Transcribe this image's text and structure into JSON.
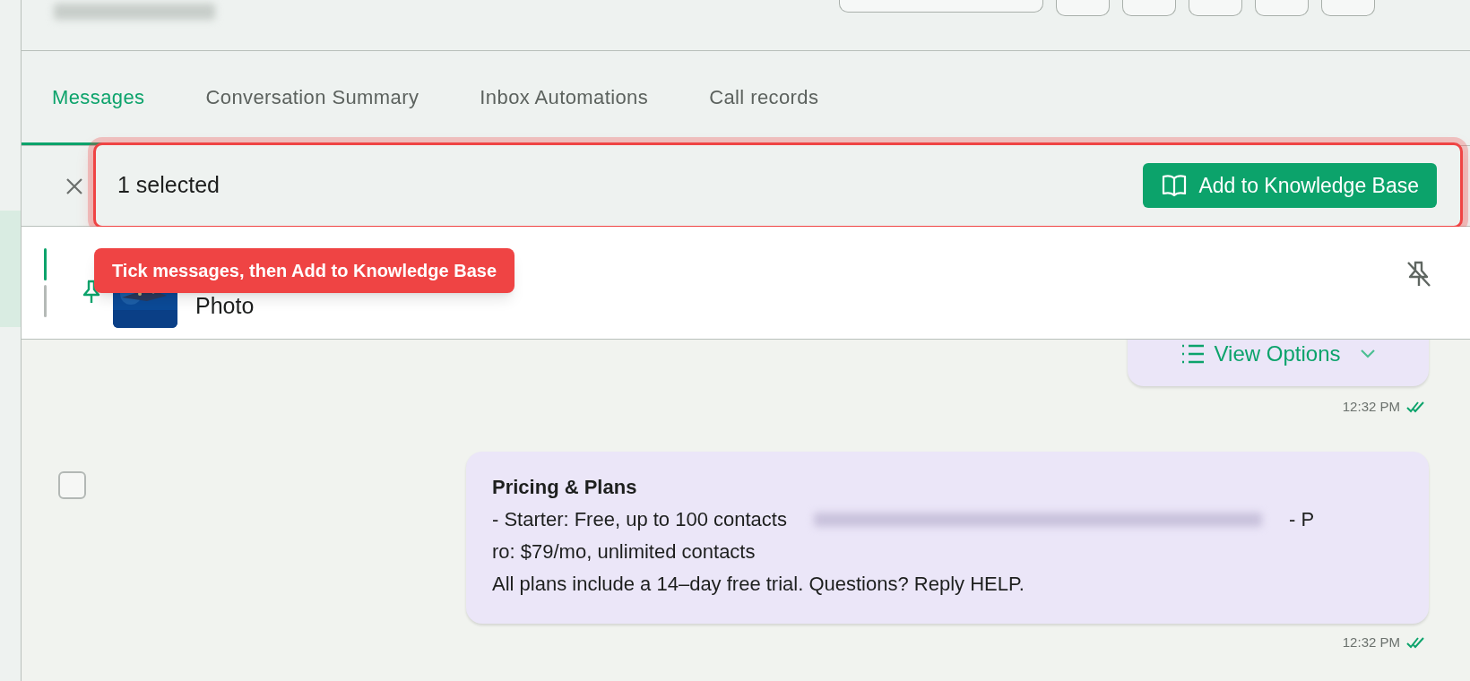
{
  "header": {
    "buttons": [
      {
        "kind": "wide"
      },
      {
        "kind": "small"
      },
      {
        "kind": "small"
      },
      {
        "kind": "small"
      },
      {
        "kind": "small"
      },
      {
        "kind": "small"
      }
    ]
  },
  "tabs": [
    {
      "label": "Messages",
      "selected": true
    },
    {
      "label": "Conversation Summary",
      "selected": false
    },
    {
      "label": "Inbox Automations",
      "selected": false
    },
    {
      "label": "Call records",
      "selected": false
    }
  ],
  "selection_bar": {
    "count_text": "1 selected",
    "highlighted": true,
    "action": "Add to Knowledge Base"
  },
  "tooltip": "Tick messages, then Add to Knowledge Base",
  "pinned": {
    "label": "Photo"
  },
  "messages": [
    {
      "kind": "options",
      "button": "View Options",
      "time": "12:32 PM"
    },
    {
      "kind": "text",
      "checked": false,
      "title": "Pricing & Plans",
      "lines": [
        [
          {
            "kind": "text",
            "text": "- Starter: Free, up to 100 contacts"
          },
          {
            "kind": "redacted"
          },
          {
            "kind": "text",
            "text": "- P"
          }
        ],
        [
          {
            "kind": "text",
            "text": "ro: $79/mo, unlimited contacts"
          }
        ],
        [
          {
            "kind": "text",
            "text": "All plans include a 14–day free trial. Questions? Reply HELP."
          }
        ]
      ],
      "time": "12:32 PM"
    }
  ]
}
